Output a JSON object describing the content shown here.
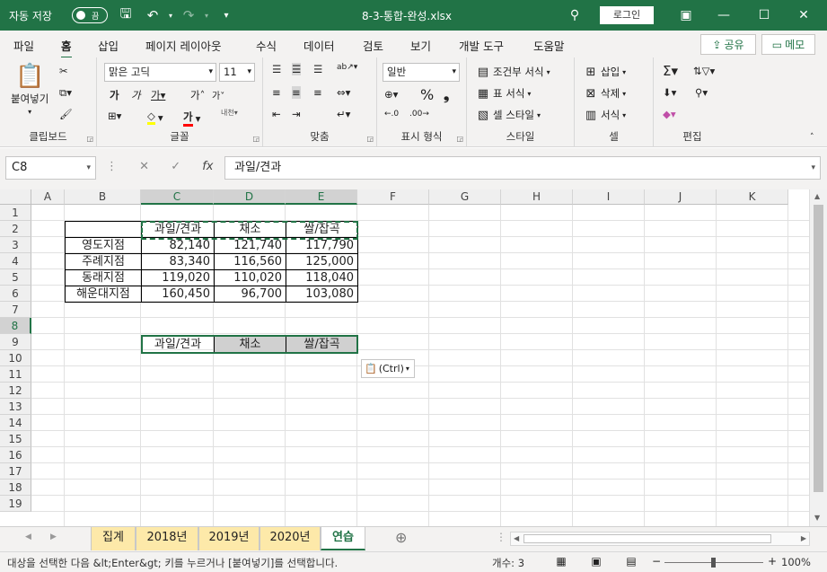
{
  "titlebar": {
    "autosave_label": "자동 저장",
    "autosave_state": "끔",
    "filename": "8-3-통합-완성.xlsx",
    "login": "로그인",
    "bg_color": "#217346"
  },
  "menu": {
    "tabs": [
      "파일",
      "홈",
      "삽입",
      "페이지 레이아웃",
      "수식",
      "데이터",
      "검토",
      "보기",
      "개발 도구",
      "도움말"
    ],
    "active": "홈",
    "share": "공유",
    "memo": "메모"
  },
  "ribbon": {
    "clipboard": {
      "paste": "붙여넣기",
      "label": "클립보드"
    },
    "font": {
      "name": "맑은 고딕",
      "size": "11",
      "label": "글꼴"
    },
    "align": {
      "label": "맞춤"
    },
    "number": {
      "format": "일반",
      "label": "표시 형식"
    },
    "styles": {
      "cond": "조건부 서식",
      "table": "표 서식",
      "cell": "셀 스타일",
      "label": "스타일"
    },
    "cells": {
      "insert": "삽입",
      "delete": "삭제",
      "format": "서식",
      "label": "셀"
    },
    "editing": {
      "label": "편집"
    }
  },
  "formula": {
    "namebox": "C8",
    "content": "과일/견과"
  },
  "grid": {
    "columns": [
      "A",
      "B",
      "C",
      "D",
      "E",
      "F",
      "G",
      "H",
      "I",
      "J",
      "K"
    ],
    "rows": [
      "1",
      "2",
      "3",
      "4",
      "5",
      "6",
      "7",
      "8",
      "9",
      "10",
      "11",
      "12",
      "13",
      "14",
      "15",
      "16",
      "17",
      "18",
      "19"
    ],
    "table": {
      "headers": [
        "과일/견과",
        "채소",
        "쌀/잡곡"
      ],
      "rows": [
        {
          "name": "영도지점",
          "values": [
            "82,140",
            "121,740",
            "117,790"
          ]
        },
        {
          "name": "주례지점",
          "values": [
            "83,340",
            "116,560",
            "125,000"
          ]
        },
        {
          "name": "동래지점",
          "values": [
            "119,020",
            "110,020",
            "118,040"
          ]
        },
        {
          "name": "해운대지점",
          "values": [
            "160,450",
            "96,700",
            "103,080"
          ]
        }
      ]
    },
    "pasted": [
      "과일/견과",
      "채소",
      "쌀/잡곡"
    ],
    "paste_ctrl": "(Ctrl)"
  },
  "sheets": {
    "tabs": [
      "집계",
      "2018년",
      "2019년",
      "2020년",
      "연습"
    ],
    "active": "연습"
  },
  "status": {
    "message": "대상을 선택한 다음 &lt;Enter&gt; 키를 누르거나 [붙여넣기]를 선택합니다.",
    "count": "개수: 3",
    "zoom": "100%"
  }
}
